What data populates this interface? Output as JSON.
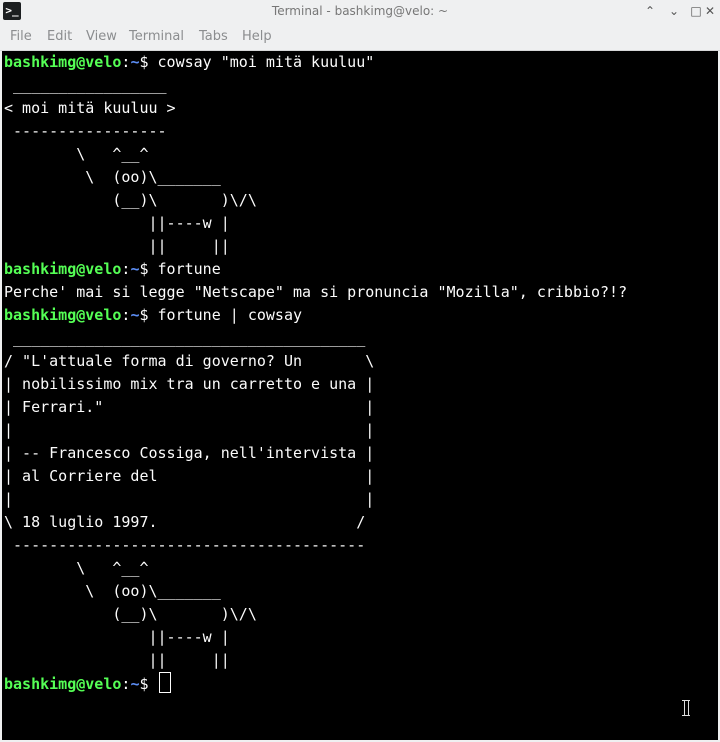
{
  "window": {
    "title": "Terminal - bashkimg@velo: ~",
    "app_icon_glyph": ">_",
    "controls": [
      {
        "name": "window-shade-button",
        "glyph": "⌃"
      },
      {
        "name": "window-minimize-button",
        "glyph": "⌄"
      },
      {
        "name": "window-maximize-button",
        "glyph": "□"
      },
      {
        "name": "window-close-button",
        "glyph": "✕"
      }
    ]
  },
  "menu": [
    {
      "name": "menu-file",
      "label": "File"
    },
    {
      "name": "menu-edit",
      "label": "Edit"
    },
    {
      "name": "menu-view",
      "label": "View"
    },
    {
      "name": "menu-terminal",
      "label": "Terminal"
    },
    {
      "name": "menu-tabs",
      "label": "Tabs"
    },
    {
      "name": "menu-help",
      "label": "Help"
    }
  ],
  "prompt": {
    "user_host": "bashkimg@velo",
    "sep": ":",
    "path": "~",
    "symbol": "$ "
  },
  "terminal_lines": [
    {
      "kind": "prompt",
      "cmd": "cowsay \"moi mitä kuuluu\""
    },
    {
      "kind": "out",
      "text": " _________________"
    },
    {
      "kind": "out",
      "text": "< moi mitä kuuluu >"
    },
    {
      "kind": "out",
      "text": " -----------------"
    },
    {
      "kind": "out",
      "text": "        \\   ^__^"
    },
    {
      "kind": "out",
      "text": "         \\  (oo)\\_______"
    },
    {
      "kind": "out",
      "text": "            (__)\\       )\\/\\"
    },
    {
      "kind": "out",
      "text": "                ||----w |"
    },
    {
      "kind": "out",
      "text": "                ||     ||"
    },
    {
      "kind": "prompt",
      "cmd": "fortune"
    },
    {
      "kind": "out",
      "text": "Perche' mai si legge \"Netscape\" ma si pronuncia \"Mozilla\", cribbio?!?"
    },
    {
      "kind": "prompt",
      "cmd": "fortune | cowsay"
    },
    {
      "kind": "out",
      "text": " _______________________________________"
    },
    {
      "kind": "out",
      "text": "/ \"L'attuale forma di governo? Un       \\"
    },
    {
      "kind": "out",
      "text": "| nobilissimo mix tra un carretto e una |"
    },
    {
      "kind": "out",
      "text": "| Ferrari.\"                             |"
    },
    {
      "kind": "out",
      "text": "|                                       |"
    },
    {
      "kind": "out",
      "text": "| -- Francesco Cossiga, nell'intervista |"
    },
    {
      "kind": "out",
      "text": "| al Corriere del                       |"
    },
    {
      "kind": "out",
      "text": "|                                       |"
    },
    {
      "kind": "out",
      "text": "\\ 18 luglio 1997.                      /"
    },
    {
      "kind": "out",
      "text": " ---------------------------------------"
    },
    {
      "kind": "out",
      "text": "        \\   ^__^"
    },
    {
      "kind": "out",
      "text": "         \\  (oo)\\_______"
    },
    {
      "kind": "out",
      "text": "            (__)\\       )\\/\\"
    },
    {
      "kind": "out",
      "text": "                ||----w |"
    },
    {
      "kind": "out",
      "text": "                ||     ||"
    },
    {
      "kind": "prompt",
      "cmd": "",
      "cursor": true
    }
  ],
  "colors": {
    "background": "#000000",
    "foreground": "#fcfcfc",
    "user_host": "#55ff55",
    "path": "#5c8ef5",
    "chrome": "#eff0f1"
  }
}
